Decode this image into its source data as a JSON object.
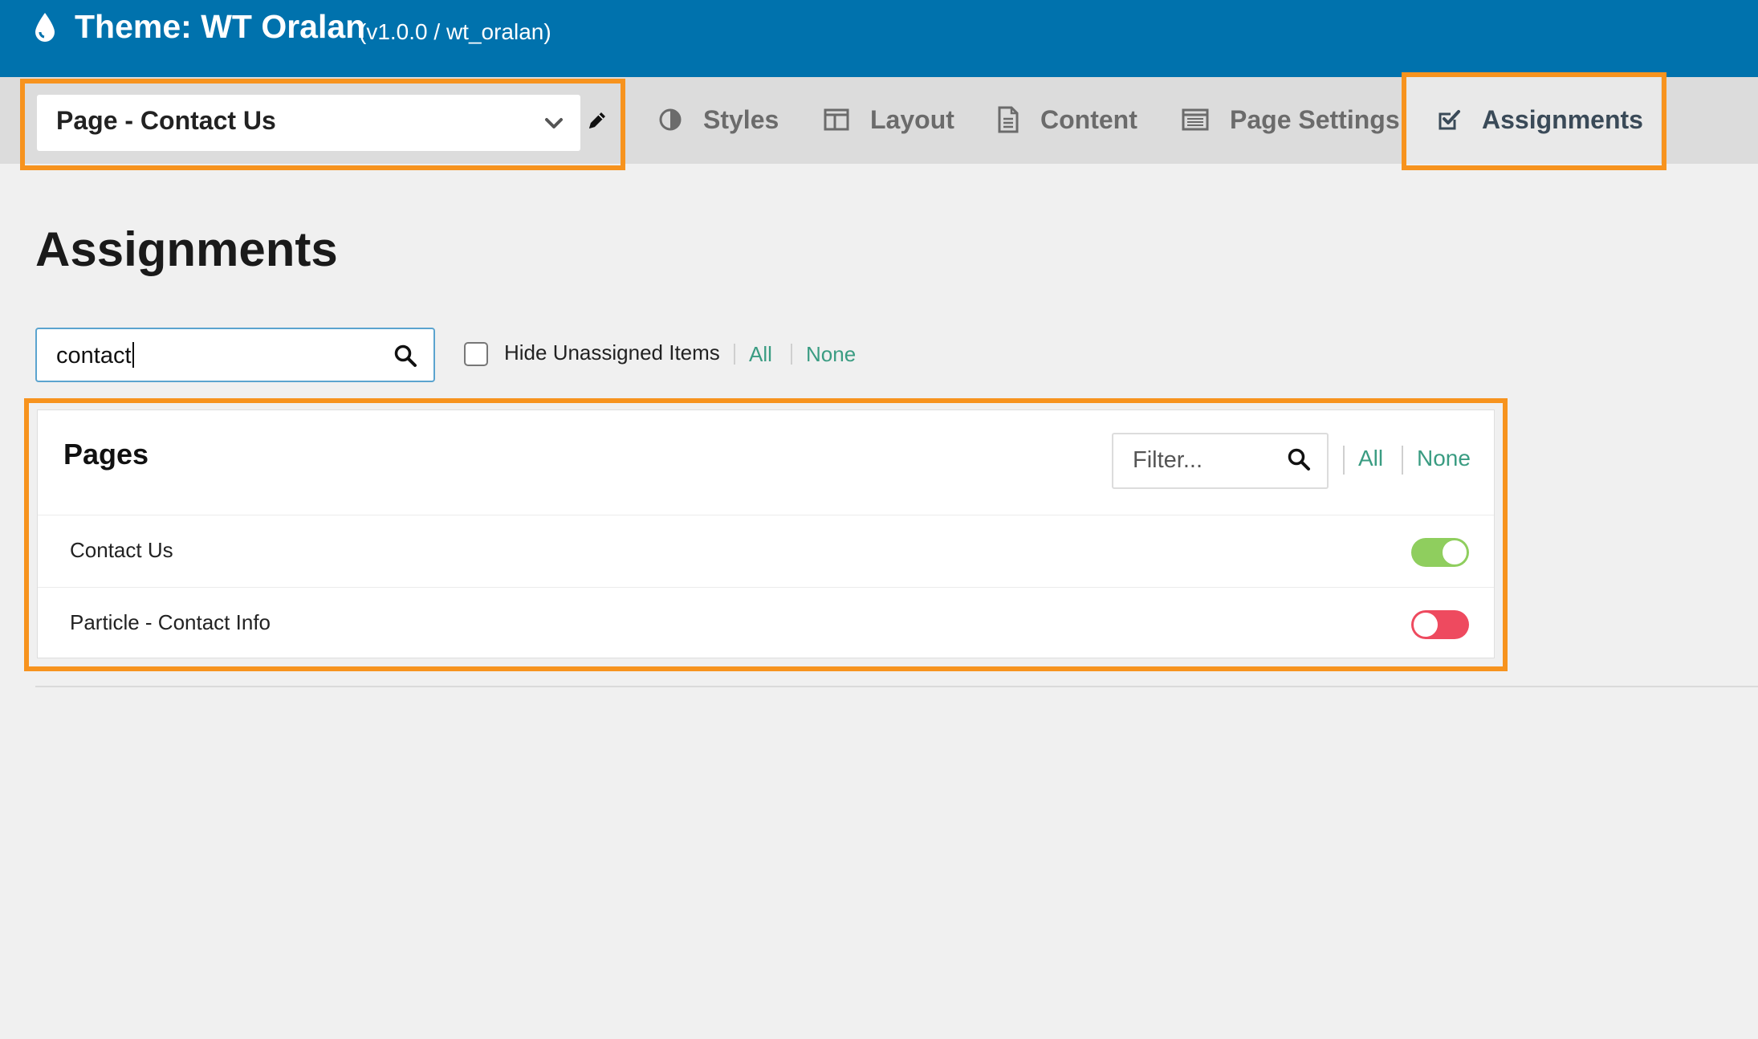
{
  "header": {
    "title": "Theme: WT Oralan",
    "version": "(v1.0.0 / wt_oralan)",
    "icon": "drop-icon"
  },
  "outline_selector": {
    "selected": "Page - Contact Us",
    "chevron_icon": "chevron-down-icon",
    "edit_icon": "pencil-icon"
  },
  "nav": {
    "items": [
      {
        "label": "Styles",
        "icon": "half-circle-icon"
      },
      {
        "label": "Layout",
        "icon": "layout-icon"
      },
      {
        "label": "Content",
        "icon": "document-icon"
      },
      {
        "label": "Page Settings",
        "icon": "page-settings-icon"
      },
      {
        "label": "Assignments",
        "icon": "checkbox-icon",
        "active": true
      }
    ]
  },
  "main": {
    "title": "Assignments",
    "search": {
      "value": "contact",
      "icon": "search-icon"
    },
    "hide_unassigned_label": "Hide Unassigned Items",
    "hide_unassigned_checked": false,
    "all_label": "All",
    "none_label": "None"
  },
  "panel": {
    "title": "Pages",
    "filter_placeholder": "Filter...",
    "all_label": "All",
    "none_label": "None",
    "rows": [
      {
        "label": "Contact Us",
        "enabled": true
      },
      {
        "label": "Particle - Contact Info",
        "enabled": false
      }
    ]
  },
  "colors": {
    "header_bg": "#0072ad",
    "highlight": "#f7931e",
    "link": "#3a9c82",
    "toggle_on": "#8fce5e",
    "toggle_off": "#ee4a5f"
  }
}
